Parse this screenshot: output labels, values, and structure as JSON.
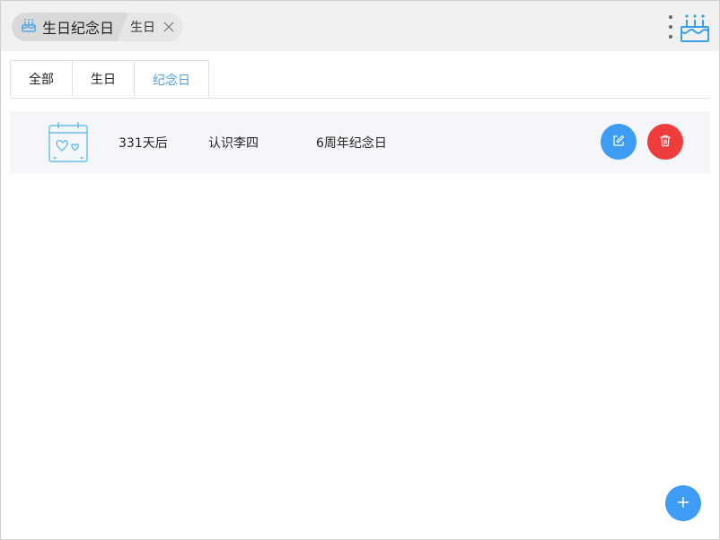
{
  "titlebar": {
    "app_title": "生日纪念日",
    "open_tab": "生日",
    "icons": {
      "app": "birthday-cake-icon",
      "close": "close-icon",
      "menu": "more-vertical-icon",
      "logo": "birthday-cake-icon"
    }
  },
  "tabs": [
    {
      "label": "全部",
      "active": false
    },
    {
      "label": "生日",
      "active": false
    },
    {
      "label": "纪念日",
      "active": true
    }
  ],
  "records": [
    {
      "icon": "calendar-hearts-icon",
      "countdown": "331天后",
      "name": "认识李四",
      "occasion": "6周年纪念日",
      "actions": {
        "edit": "edit-icon",
        "delete": "trash-icon"
      }
    }
  ],
  "fab": {
    "icon": "plus-icon"
  },
  "colors": {
    "accent": "#3e9cf5",
    "danger": "#ef3d3d",
    "row_bg": "#f4f6fa",
    "titlebar_bg": "#f1f1f1",
    "active_tab_text": "#4a9fe0"
  }
}
